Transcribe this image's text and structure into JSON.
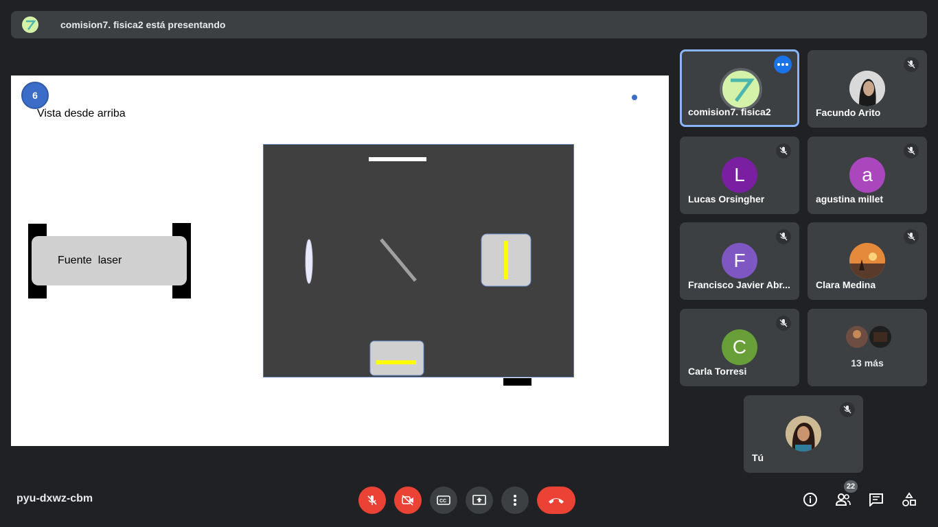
{
  "banner": {
    "presenter_text": "comision7. fisica2 está presentando"
  },
  "slide": {
    "number": "6",
    "subtitle": "Vista desde arriba",
    "laser_label": "Fuente  laser"
  },
  "participants": [
    {
      "name": "comision7. fisica2",
      "avatar": "logo-7",
      "active": true
    },
    {
      "name": "Facundo Arito",
      "avatar": "photo",
      "muted": true
    },
    {
      "name": "Lucas Orsingher",
      "initial": "L",
      "color": "#7b1fa2",
      "muted": true
    },
    {
      "name": "agustina millet",
      "initial": "a",
      "color": "#ab47bc",
      "muted": true
    },
    {
      "name": "Francisco Javier Abr...",
      "initial": "F",
      "color": "#7e57c2",
      "muted": true
    },
    {
      "name": "Clara Medina",
      "avatar": "photo",
      "muted": true
    },
    {
      "name": "Carla Torresi",
      "initial": "C",
      "color": "#689f38",
      "muted": true
    },
    {
      "more_label": "13 más"
    },
    {
      "name": "Tú",
      "avatar": "photo",
      "muted": true
    }
  ],
  "footer": {
    "meeting_code": "pyu-dxwz-cbm",
    "people_count": "22"
  },
  "colors": {
    "background": "#202124",
    "tile": "#3c4043",
    "danger": "#ea4335",
    "accent": "#1a73e8"
  }
}
